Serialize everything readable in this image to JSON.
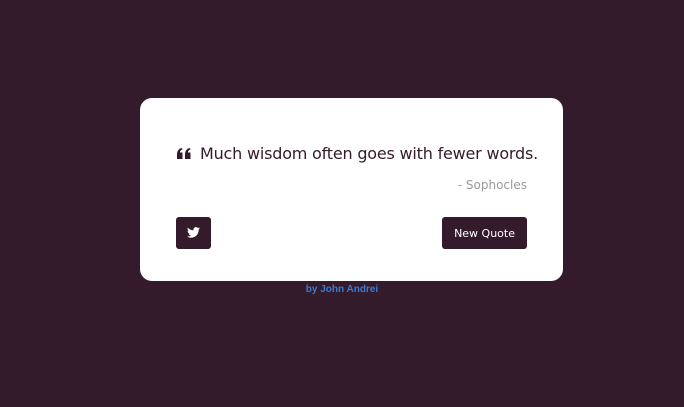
{
  "quote": {
    "text": "Much wisdom often goes with fewer words.",
    "author": "- Sophocles"
  },
  "actions": {
    "new_quote_label": "New Quote"
  },
  "footer": {
    "credit": "by John Andrei"
  },
  "icons": {
    "quote": "quote-left-icon",
    "tweet": "twitter-icon"
  },
  "colors": {
    "background": "#331b2c",
    "card": "#ffffff",
    "button": "#331b2c",
    "author": "#9a9a9a",
    "credit_link": "#3a7bd5"
  }
}
